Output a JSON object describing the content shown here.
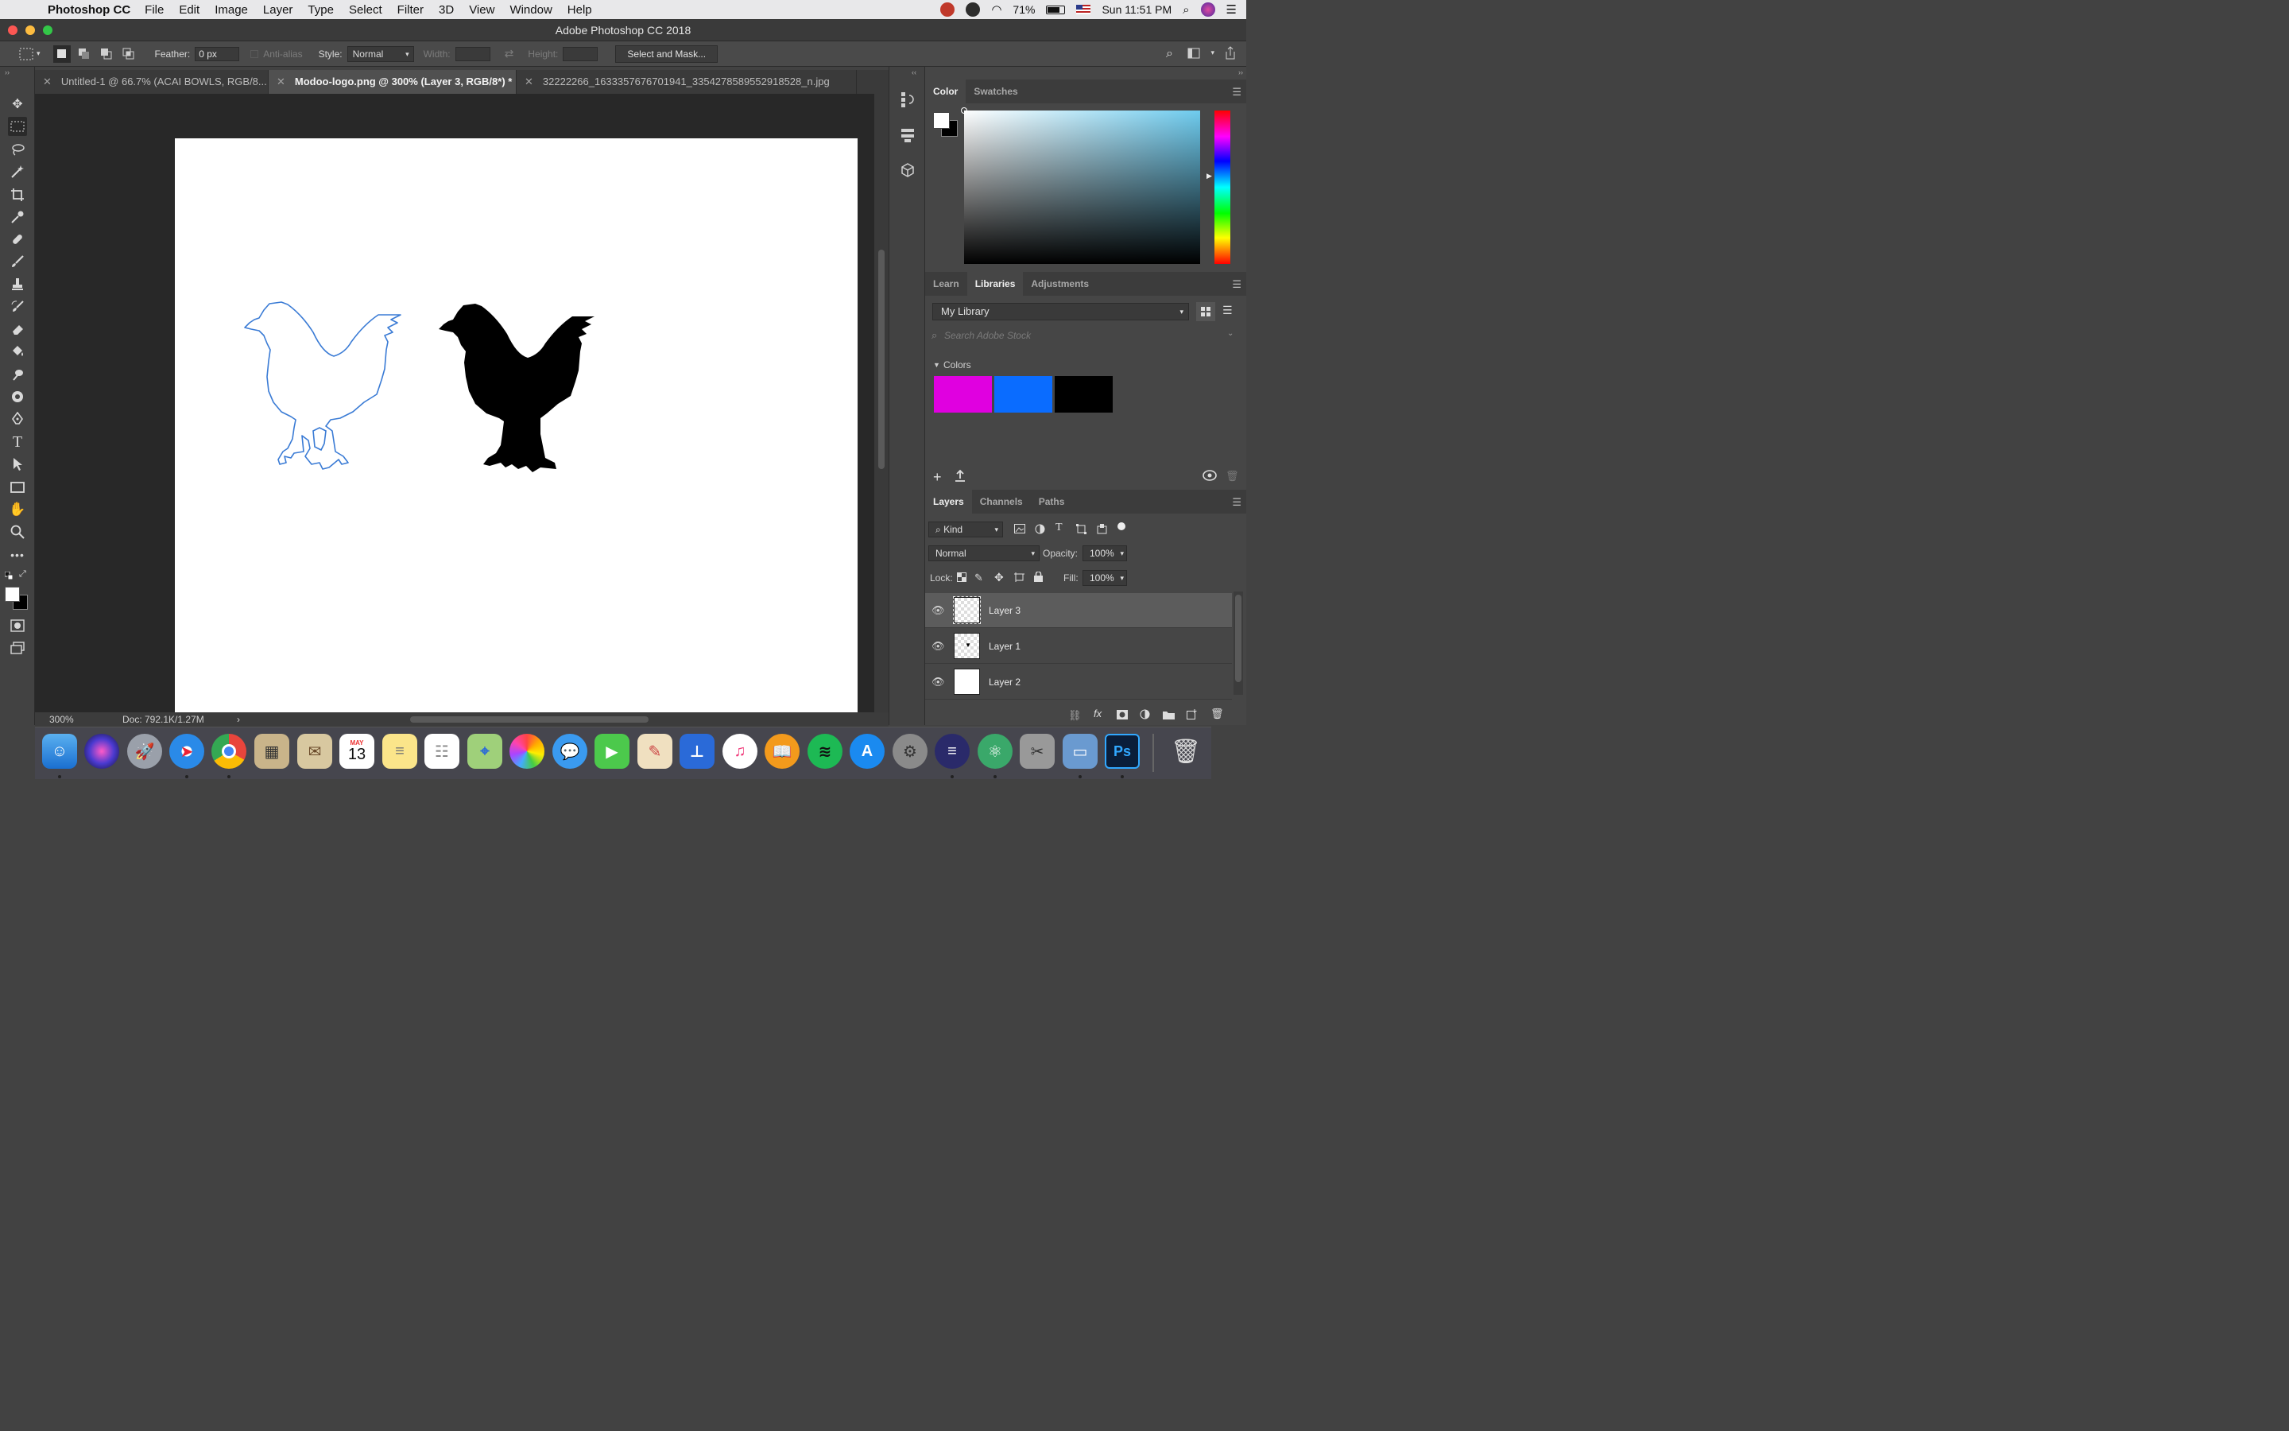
{
  "menubar": {
    "app_name": "Photoshop CC",
    "menus": [
      "File",
      "Edit",
      "Image",
      "Layer",
      "Type",
      "Select",
      "Filter",
      "3D",
      "View",
      "Window",
      "Help"
    ],
    "battery": "71%",
    "clock": "Sun 11:51 PM"
  },
  "titlebar": {
    "title": "Adobe Photoshop CC 2018"
  },
  "options": {
    "feather_label": "Feather:",
    "feather_value": "0 px",
    "antialias_label": "Anti-alias",
    "style_label": "Style:",
    "style_value": "Normal",
    "width_label": "Width:",
    "height_label": "Height:",
    "select_mask_label": "Select and Mask..."
  },
  "doc_tabs": [
    {
      "label": "Untitled-1 @ 66.7% (ACAI BOWLS, RGB/8..."
    },
    {
      "label": "Modoo-logo.png @ 300% (Layer 3, RGB/8*) *"
    },
    {
      "label": "32222266_1633357676701941_3354278589552918528_n.jpg"
    }
  ],
  "status": {
    "zoom": "300%",
    "doc_size": "Doc: 792.1K/1.27M"
  },
  "color_panel": {
    "tabs": [
      "Color",
      "Swatches"
    ]
  },
  "libraries_panel": {
    "tabs": [
      "Learn",
      "Libraries",
      "Adjustments"
    ],
    "library": "My Library",
    "search_placeholder": "Search Adobe Stock",
    "colors_heading": "Colors",
    "colors": [
      "#e000e0",
      "#0a6cff",
      "#000000"
    ]
  },
  "layers_panel": {
    "tabs": [
      "Layers",
      "Channels",
      "Paths"
    ],
    "filter_kind": "Kind",
    "blend_mode": "Normal",
    "opacity_label": "Opacity:",
    "opacity_value": "100%",
    "lock_label": "Lock:",
    "fill_label": "Fill:",
    "fill_value": "100%",
    "layers": [
      {
        "name": "Layer 3"
      },
      {
        "name": "Layer 1"
      },
      {
        "name": "Layer 2"
      }
    ]
  },
  "dock": {
    "calendar_month": "MAY",
    "calendar_day": "13",
    "ps_label": "Ps"
  },
  "accent": {
    "selection_outline": "#3a7bd5",
    "silhouette": "#000000"
  }
}
